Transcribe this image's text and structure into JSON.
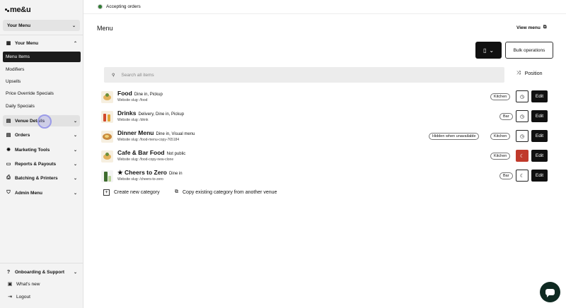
{
  "brand": {
    "logo_text": "me&u"
  },
  "sidebar": {
    "menu_select": "Your Menu",
    "groups": [
      {
        "label": "Your Menu",
        "icon": "grid-icon"
      },
      {
        "label": "Venue Details",
        "icon": "store-icon"
      },
      {
        "label": "Orders",
        "icon": "receipt-icon"
      },
      {
        "label": "Marketing Tools",
        "icon": "gear-icon"
      },
      {
        "label": "Reports & Payouts",
        "icon": "card-icon"
      },
      {
        "label": "Batching & Printers",
        "icon": "printer-icon"
      },
      {
        "label": "Admin Menu",
        "icon": "shield-icon"
      }
    ],
    "sub_items": [
      "Menu Items",
      "Modifiers",
      "Upsells",
      "Price Override Specials",
      "Daily Specials"
    ],
    "footer": [
      {
        "label": "Onboarding & Support",
        "icon": "help-icon"
      },
      {
        "label": "What's new",
        "icon": "gift-icon"
      },
      {
        "label": "Logout",
        "icon": "logout-icon"
      }
    ]
  },
  "topbar": {
    "status": "Accepting orders",
    "status_color": "#2e7d32"
  },
  "main": {
    "title": "Menu",
    "view_menu": "View menu",
    "bulk_operations": "Bulk operations",
    "search_placeholder": "Search all items",
    "position": "Position",
    "create_category": "Create new category",
    "copy_category": "Copy existing category from another venue"
  },
  "categories": [
    {
      "name": "Food",
      "tags": "Dine in, Pickup",
      "slug": "Website slug: /food",
      "pills": [
        "Kitchen"
      ],
      "action_icon": "clock-icon",
      "action_glyph": "◷",
      "edit": "Edit"
    },
    {
      "name": "Drinks",
      "tags": "Delivery, Dine in, Pickup",
      "slug": "Website slug: /drink",
      "pills": [
        "Bar"
      ],
      "action_icon": "clock-icon",
      "action_glyph": "◷",
      "edit": "Edit"
    },
    {
      "name": "Dinner Menu",
      "tags": "Dine in, Visual menu",
      "slug": "Website slug: /food-menu-copy-765184",
      "pills": [
        "Hidden when unavailable",
        "Kitchen"
      ],
      "action_icon": "clock-icon",
      "action_glyph": "◷",
      "edit": "Edit"
    },
    {
      "name": "Cafe & Bar Food",
      "tags": "Not public",
      "slug": "Website slug: /food-copy-new-clone",
      "pills": [
        "Kitchen"
      ],
      "action_icon": "moon-icon",
      "action_glyph": "☾",
      "edit": "Edit"
    },
    {
      "name": "★ Cheers to Zero",
      "tags": "Dine in",
      "slug": "Website slug: /cheers-to-zero",
      "pills": [
        "Bar"
      ],
      "action_icon": "moon-icon",
      "action_glyph": "☾",
      "edit": "Edit"
    }
  ]
}
